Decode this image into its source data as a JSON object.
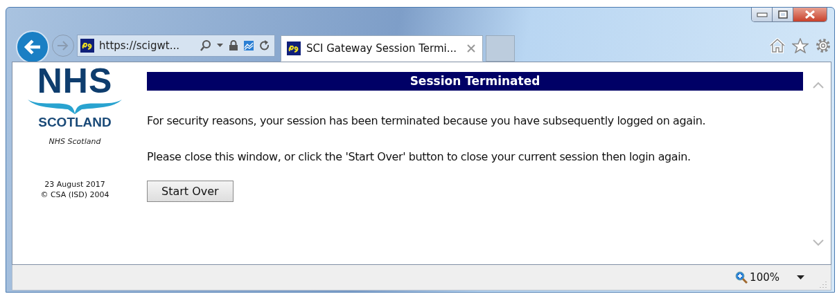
{
  "address_bar": {
    "url": "https://scigwt..."
  },
  "tabs": [
    {
      "title": "SCI Gateway Session Termi...",
      "selected": true
    }
  ],
  "sidebar": {
    "logo": {
      "line1": "NHS",
      "line2": "SCOTLAND"
    },
    "caption": "NHS Scotland",
    "date": "23 August 2017",
    "copyright": "© CSA (ISD) 2004"
  },
  "main": {
    "heading": "Session Terminated",
    "paragraphs": [
      "For security reasons, your session has been terminated because you have subsequently logged on again.",
      "Please close this window, or click the 'Start Over' button to close your current session then login again."
    ],
    "button": "Start Over"
  },
  "status_bar": {
    "zoom": "100%"
  }
}
